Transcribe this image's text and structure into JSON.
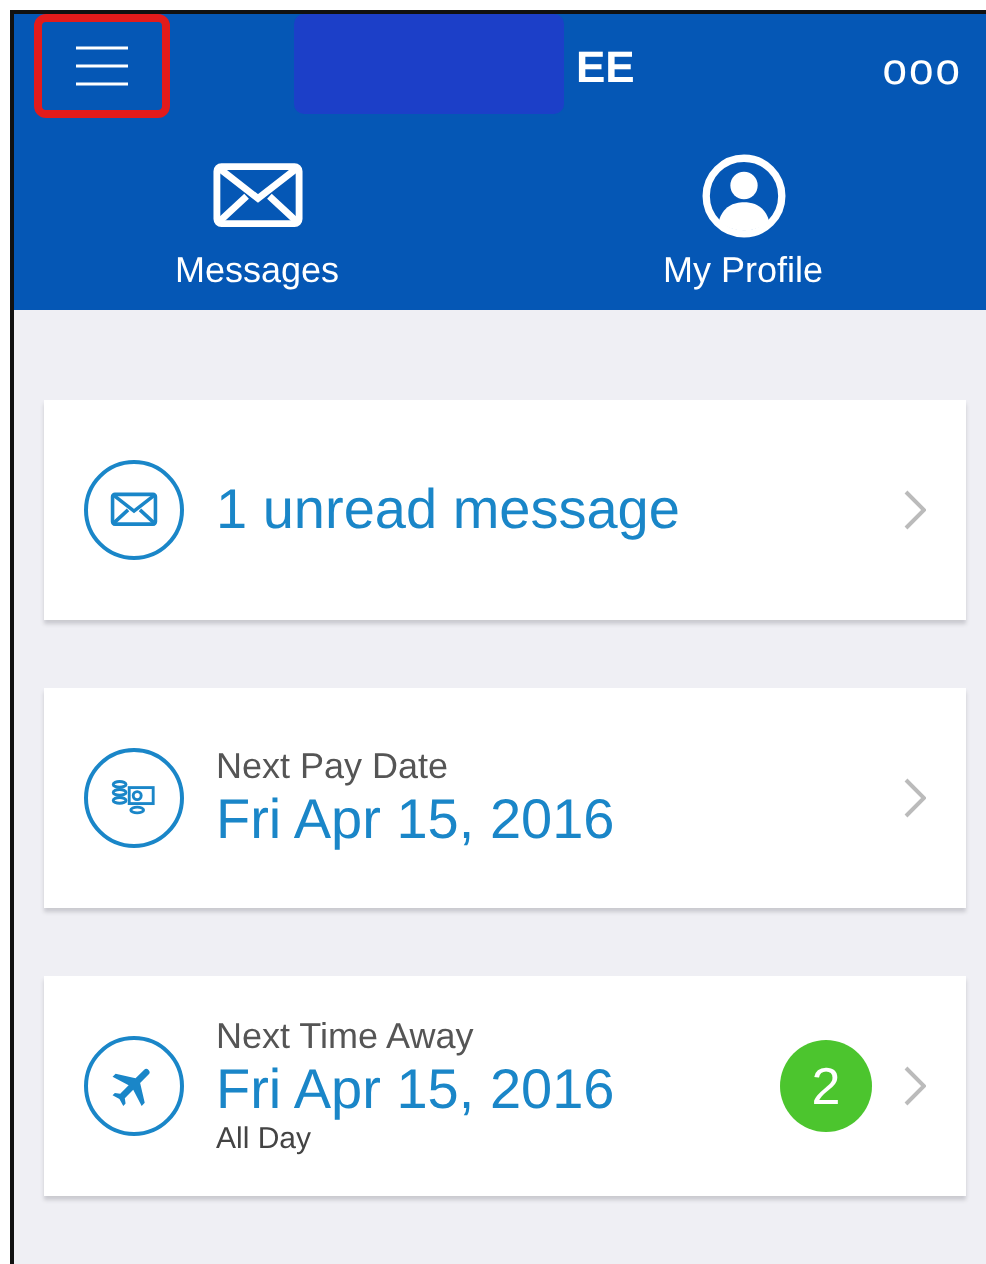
{
  "header": {
    "title": "EE",
    "title_redacted": true,
    "menu_highlighted": true,
    "more": "ooo"
  },
  "nav": [
    {
      "label": "Messages",
      "kind": "messages"
    },
    {
      "label": "My Profile",
      "kind": "profile"
    }
  ],
  "cards": [
    {
      "kind": "message",
      "text": "1 unread message"
    },
    {
      "kind": "pay",
      "label": "Next Pay Date",
      "date": "Fri Apr 15, 2016"
    },
    {
      "kind": "away",
      "label": "Next Time Away",
      "date": "Fri Apr 15, 2016",
      "note": "All Day",
      "badge": "2"
    }
  ]
}
